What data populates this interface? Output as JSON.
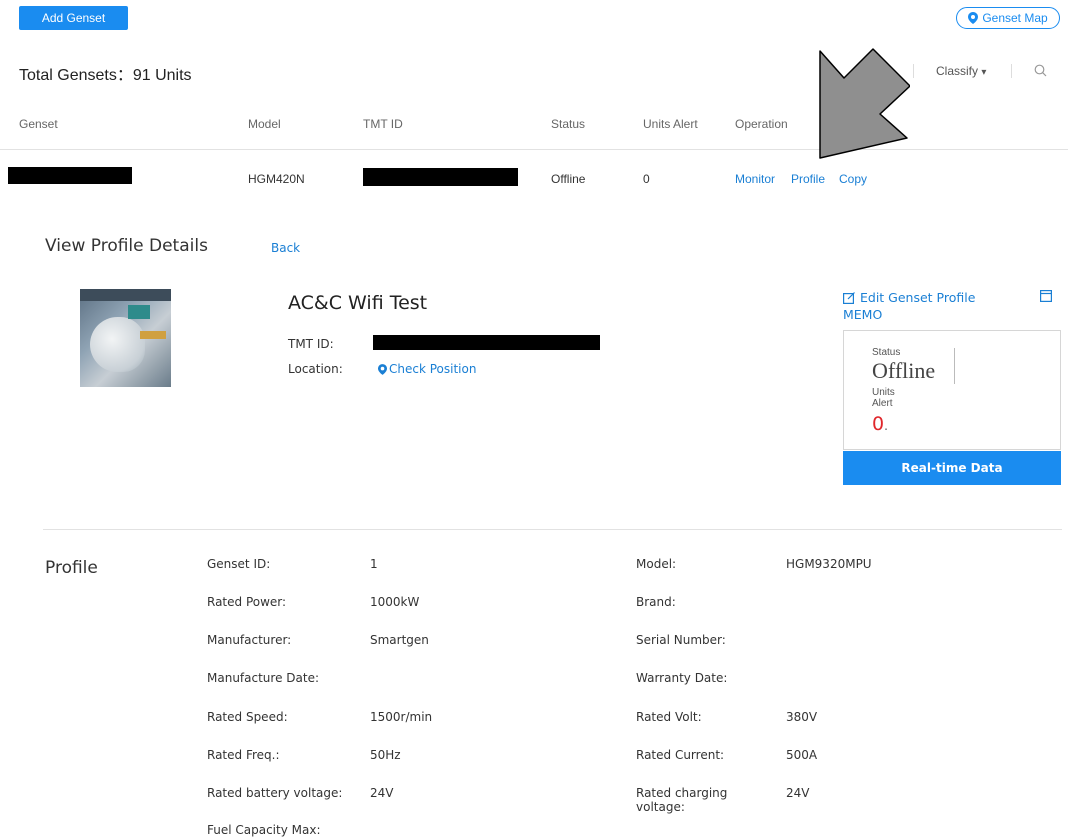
{
  "toolbar": {
    "add_genset_label": "Add Genset",
    "genset_map_label": "Genset Map",
    "total_label": "Total Gensets：91 Units",
    "classify_label": "Classify",
    "classify_arrow": "▾",
    "search_icon": "search-icon"
  },
  "table": {
    "headers": [
      "Genset",
      "Model",
      "TMT ID",
      "Status",
      "Units Alert",
      "Operation"
    ],
    "row": {
      "model": "HGM420N",
      "status": "Offline",
      "units_alert": "0",
      "ops": [
        "Monitor",
        "Profile",
        "Copy"
      ]
    }
  },
  "detail": {
    "heading": "View Profile Details",
    "back_label": "Back",
    "name": "AC&C Wifi Test",
    "tmt_label": "TMT ID:",
    "location_label": "Location:",
    "check_position_label": "Check Position",
    "edit_label": "Edit Genset Profile",
    "memo_label": "MEMO",
    "status_caption": "Status",
    "status_value": "Offline",
    "units_caption_1": "Units",
    "units_caption_2": "Alert",
    "units_value": "0",
    "units_suffix": ".",
    "realtime_label": "Real-time Data"
  },
  "profile": {
    "heading": "Profile",
    "left": [
      {
        "label": "Genset ID:",
        "value": "1"
      },
      {
        "label": "Rated Power:",
        "value": "1000kW"
      },
      {
        "label": "Manufacturer:",
        "value": "Smartgen"
      },
      {
        "label": "Manufacture Date:",
        "value": ""
      },
      {
        "label": "Rated Speed:",
        "value": "1500r/min"
      },
      {
        "label": "Rated Freq.:",
        "value": "50Hz"
      },
      {
        "label": "Rated battery voltage:",
        "value": "24V"
      },
      {
        "label": "Fuel Capacity Max:",
        "value": ""
      }
    ],
    "right": [
      {
        "label": "Model:",
        "value": "HGM9320MPU"
      },
      {
        "label": "Brand:",
        "value": ""
      },
      {
        "label": "Serial Number:",
        "value": ""
      },
      {
        "label": "Warranty Date:",
        "value": ""
      },
      {
        "label": "Rated Volt:",
        "value": "380V"
      },
      {
        "label": "Rated Current:",
        "value": "500A"
      },
      {
        "label": "Rated charging voltage:",
        "value": "24V"
      }
    ]
  },
  "colors": {
    "accent": "#1a8cf0",
    "alert_red": "#e0262b"
  }
}
